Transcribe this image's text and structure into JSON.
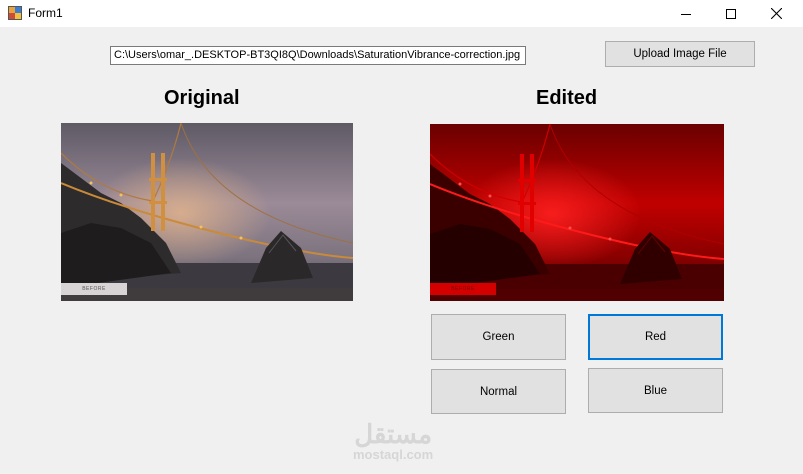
{
  "window": {
    "title": "Form1"
  },
  "path_input": {
    "value": "C:\\Users\\omar_.DESKTOP-BT3QI8Q\\Downloads\\SaturationVibrance-correction.jpg"
  },
  "upload_button": {
    "label": "Upload Image File"
  },
  "original": {
    "heading": "Original",
    "chip_text": "BEFORE"
  },
  "edited": {
    "heading": "Edited",
    "chip_text": "BEFORE"
  },
  "filter_buttons": {
    "green": "Green",
    "red": "Red",
    "normal": "Normal",
    "blue": "Blue",
    "focused": "Red"
  },
  "watermark": {
    "arabic": "مستقل",
    "latin": "mostaql.com"
  },
  "colors": {
    "accent": "#0078d7",
    "button_bg": "#e1e1e1",
    "window_bg": "#f0f0f0"
  },
  "icons": [
    "app-icon",
    "minimize-icon",
    "maximize-icon",
    "close-icon"
  ]
}
